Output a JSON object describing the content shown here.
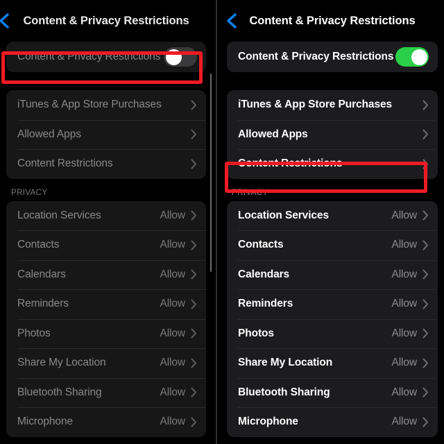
{
  "panels": {
    "left": {
      "state": "disabled",
      "nav": {
        "back_icon": "chevron-left-icon",
        "title": "Content & Privacy Restrictions"
      },
      "toggle": {
        "label": "Content & Privacy Restrictions",
        "state": "off",
        "icon": "toggle-switch-off-icon"
      },
      "restrictions": [
        {
          "label": "iTunes & App Store Purchases"
        },
        {
          "label": "Allowed Apps"
        },
        {
          "label": "Content Restrictions"
        }
      ],
      "privacy_header": "PRIVACY",
      "privacy": [
        {
          "label": "Location Services",
          "value": "Allow"
        },
        {
          "label": "Contacts",
          "value": "Allow"
        },
        {
          "label": "Calendars",
          "value": "Allow"
        },
        {
          "label": "Reminders",
          "value": "Allow"
        },
        {
          "label": "Photos",
          "value": "Allow"
        },
        {
          "label": "Share My Location",
          "value": "Allow"
        },
        {
          "label": "Bluetooth Sharing",
          "value": "Allow"
        },
        {
          "label": "Microphone",
          "value": "Allow"
        }
      ],
      "highlight": "content-privacy-restrictions-toggle-row"
    },
    "right": {
      "state": "enabled",
      "nav": {
        "back_icon": "chevron-left-icon",
        "title": "Content & Privacy Restrictions"
      },
      "toggle": {
        "label": "Content & Privacy Restrictions",
        "state": "on",
        "icon": "toggle-switch-on-icon"
      },
      "restrictions": [
        {
          "label": "iTunes & App Store Purchases"
        },
        {
          "label": "Allowed Apps"
        },
        {
          "label": "Content Restrictions"
        }
      ],
      "privacy_header": "PRIVACY",
      "privacy": [
        {
          "label": "Location Services",
          "value": "Allow"
        },
        {
          "label": "Contacts",
          "value": "Allow"
        },
        {
          "label": "Calendars",
          "value": "Allow"
        },
        {
          "label": "Reminders",
          "value": "Allow"
        },
        {
          "label": "Photos",
          "value": "Allow"
        },
        {
          "label": "Share My Location",
          "value": "Allow"
        },
        {
          "label": "Bluetooth Sharing",
          "value": "Allow"
        },
        {
          "label": "Microphone",
          "value": "Allow"
        }
      ],
      "highlight": "content-restrictions-row"
    }
  },
  "colors": {
    "background": "#000000",
    "card": "#1c1c1e",
    "card_disabled": "#171718",
    "accent_blue": "#0a84ff",
    "toggle_on_green": "#2ad04a",
    "toggle_off_gray": "#3a3a3c",
    "annotation_red": "#ee1b24",
    "text_primary": "#ffffff",
    "text_secondary": "#8d8d92",
    "text_disabled": "#898989"
  }
}
